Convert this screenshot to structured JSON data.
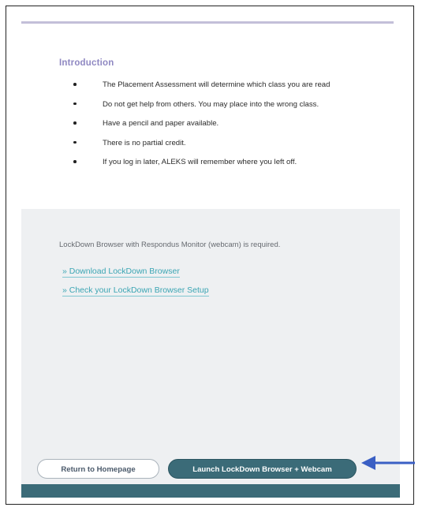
{
  "intro": {
    "title": "Introduction",
    "bullets": [
      "The Placement Assessment will determine which class you are read",
      "Do not get help from others. You may place into the wrong class.",
      "Have a pencil and paper available.",
      "There is no partial credit.",
      "If you log in later, ALEKS will remember where you left off."
    ]
  },
  "lockdown": {
    "notice": "LockDown Browser with Respondus Monitor (webcam) is required.",
    "links": [
      "» Download LockDown Browser",
      "» Check your LockDown Browser Setup"
    ]
  },
  "footer": {
    "return_label": "Return to Homepage",
    "launch_label": "Launch LockDown Browser + Webcam"
  },
  "colors": {
    "accent": "#3b6b78",
    "link": "#3ba5b3",
    "heading": "#8f88c2",
    "annotation_arrow": "#3a5fc4"
  },
  "icons": [
    "right-pointing-arrow-annotation"
  ]
}
